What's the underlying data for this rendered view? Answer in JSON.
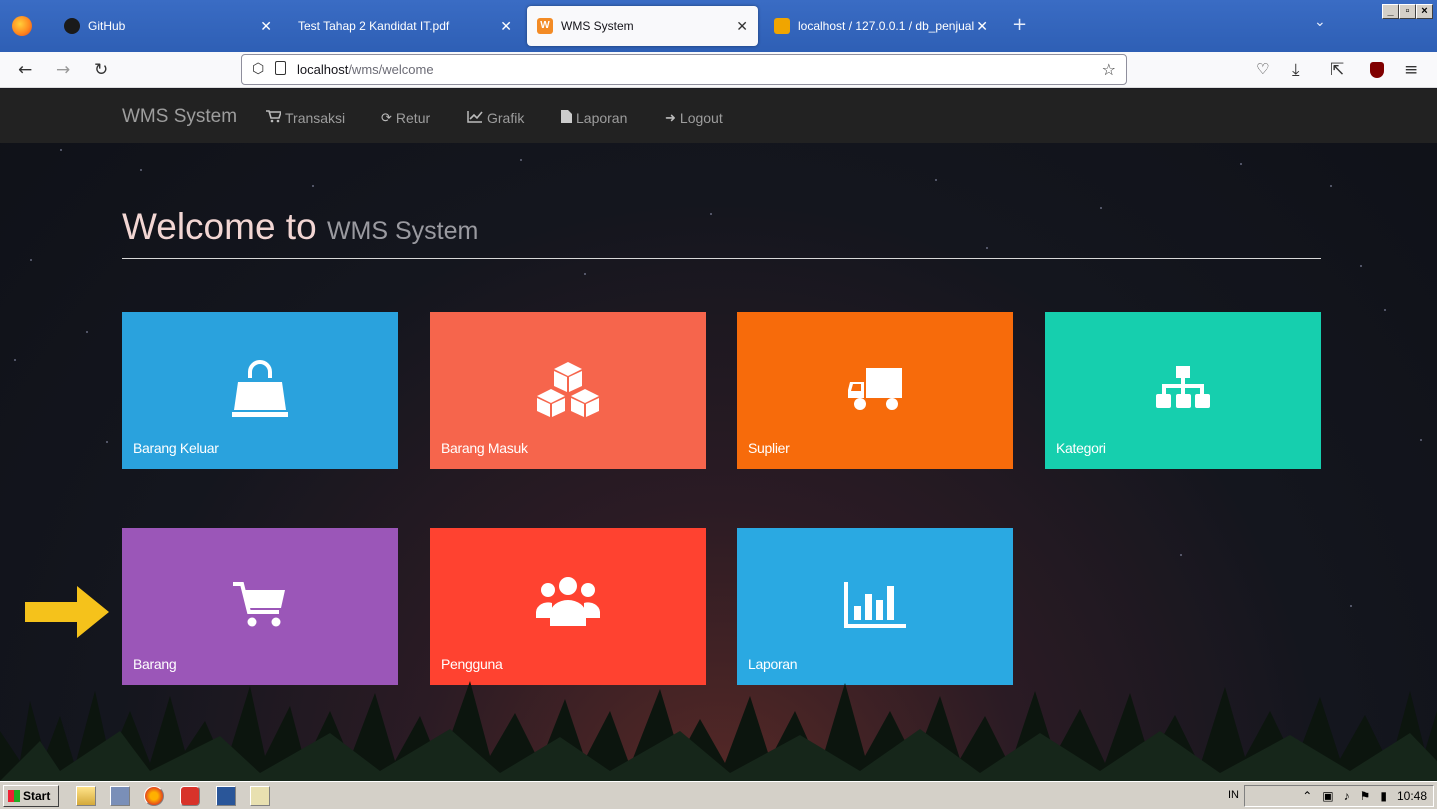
{
  "browser": {
    "tabs": [
      {
        "title": "GitHub",
        "active": false
      },
      {
        "title": "Test Tahap 2 Kandidat IT.pdf",
        "active": false
      },
      {
        "title": "WMS System",
        "active": true
      },
      {
        "title": "localhost / 127.0.0.1 / db_penjual",
        "active": false
      }
    ],
    "url_host": "localhost",
    "url_path": "/wms/welcome"
  },
  "site": {
    "brand": "WMS System",
    "nav": [
      {
        "label": "Transaksi",
        "icon": "cart-icon"
      },
      {
        "label": "Retur",
        "icon": "refresh-icon"
      },
      {
        "label": "Grafik",
        "icon": "line-chart-icon"
      },
      {
        "label": "Laporan",
        "icon": "file-icon"
      },
      {
        "label": "Logout",
        "icon": "logout-icon"
      }
    ],
    "welcome_main": "Welcome to",
    "welcome_sub": "WMS System"
  },
  "tiles": [
    {
      "label": "Barang Keluar",
      "icon": "shopping-bag-icon",
      "color": "#2aa2dd"
    },
    {
      "label": "Barang Masuk",
      "icon": "cubes-icon",
      "color": "#f6654c"
    },
    {
      "label": "Suplier",
      "icon": "truck-icon",
      "color": "#f76b0b"
    },
    {
      "label": "Kategori",
      "icon": "sitemap-icon",
      "color": "#16cfae"
    },
    {
      "label": "Barang",
      "icon": "cart-icon",
      "color": "#9b56b8"
    },
    {
      "label": "Pengguna",
      "icon": "users-icon",
      "color": "#ff4230"
    },
    {
      "label": "Laporan",
      "icon": "bar-chart-icon",
      "color": "#2aa9e2"
    }
  ],
  "taskbar": {
    "start_label": "Start",
    "lang": "IN",
    "clock": "10:48"
  }
}
